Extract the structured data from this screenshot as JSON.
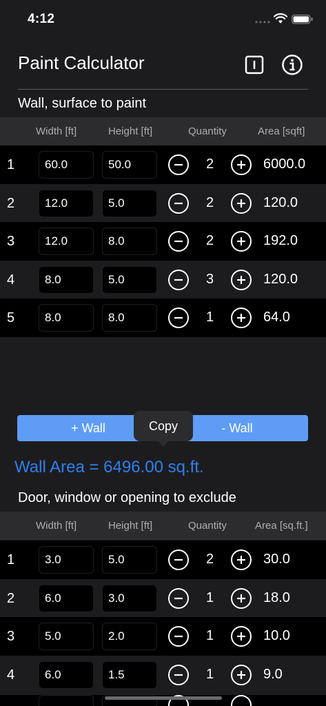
{
  "status_bar": {
    "time": "4:12"
  },
  "header": {
    "title": "Paint Calculator"
  },
  "icons": {
    "tab": "tab-icon",
    "info": "info-icon",
    "minus": "minus-circle-icon",
    "plus": "plus-circle-icon"
  },
  "walls": {
    "section_title": "Wall, surface to paint",
    "columns": {
      "width": "Width [ft]",
      "height": "Height [ft]",
      "quantity": "Quantity",
      "area": "Area [sqft]"
    },
    "rows": [
      {
        "num": "1",
        "width": "60.0",
        "height": "50.0",
        "qty": "2",
        "area": "6000.0"
      },
      {
        "num": "2",
        "width": "12.0",
        "height": "5.0",
        "qty": "2",
        "area": "120.0"
      },
      {
        "num": "3",
        "width": "12.0",
        "height": "8.0",
        "qty": "2",
        "area": "192.0"
      },
      {
        "num": "4",
        "width": "8.0",
        "height": "5.0",
        "qty": "3",
        "area": "120.0"
      },
      {
        "num": "5",
        "width": "8.0",
        "height": "8.0",
        "qty": "1",
        "area": "64.0"
      }
    ]
  },
  "actions": {
    "add_wall": "+ Wall",
    "remove_wall": "- Wall",
    "copy": "Copy"
  },
  "wall_area_total": "Wall Area = 6496.00 sq.ft.",
  "openings": {
    "section_title": "Door, window or opening to exclude",
    "columns": {
      "width": "Width [ft]",
      "height": "Height [ft]",
      "quantity": "Quantity",
      "area": "Area [sq.ft.]"
    },
    "rows": [
      {
        "num": "1",
        "width": "3.0",
        "height": "5.0",
        "qty": "2",
        "area": "30.0"
      },
      {
        "num": "2",
        "width": "6.0",
        "height": "3.0",
        "qty": "1",
        "area": "18.0"
      },
      {
        "num": "3",
        "width": "5.0",
        "height": "2.0",
        "qty": "1",
        "area": "10.0"
      },
      {
        "num": "4",
        "width": "6.0",
        "height": "1.5",
        "qty": "1",
        "area": "9.0"
      }
    ]
  },
  "colors": {
    "accent": "#5e9cf6",
    "total_text": "#2f7ff0",
    "background": "#1c1c1e"
  }
}
